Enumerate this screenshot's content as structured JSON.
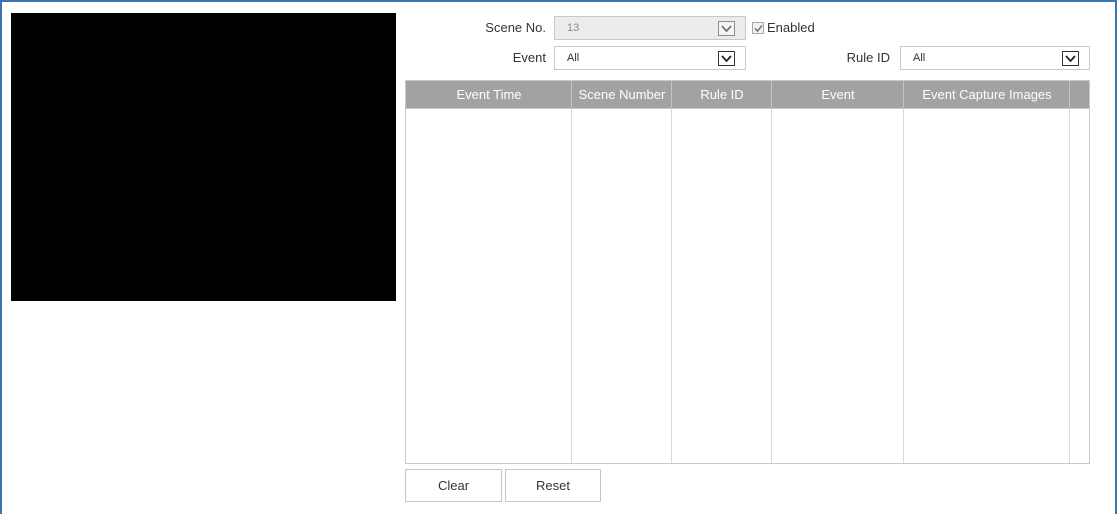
{
  "filters": {
    "scene_label": "Scene No.",
    "scene_value": "13",
    "enabled_label": "Enabled",
    "enabled_checked": true,
    "event_label": "Event",
    "event_value": "All",
    "rule_label": "Rule ID",
    "rule_value": "All"
  },
  "table": {
    "columns": [
      "Event Time",
      "Scene Number",
      "Rule ID",
      "Event",
      "Event Capture Images"
    ],
    "rows": []
  },
  "buttons": {
    "clear": "Clear",
    "reset": "Reset"
  },
  "colors": {
    "frame": "#3f74b3",
    "video": "#000000",
    "header_bg": "#a2a2a2"
  },
  "icons": {
    "dropdown": "chevron-down-icon",
    "checkbox": "checkmark-icon"
  }
}
